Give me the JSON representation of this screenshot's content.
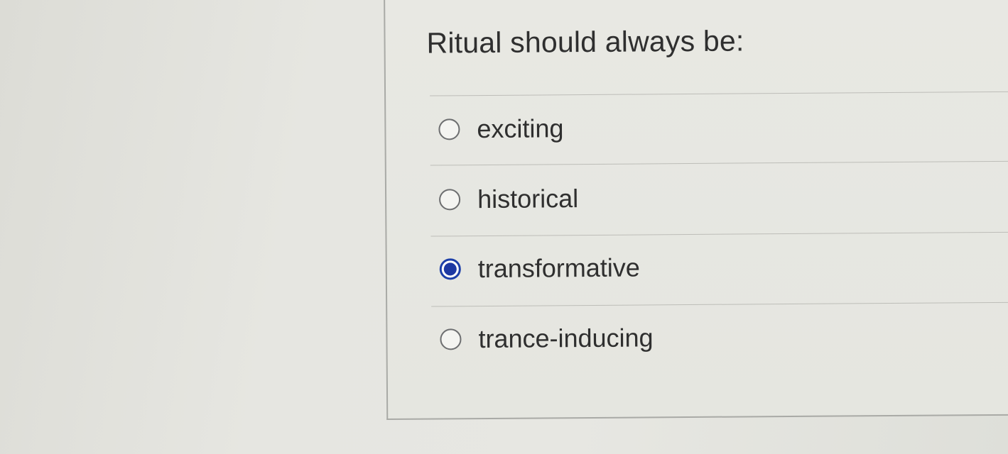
{
  "question": {
    "text": "Ritual should always be:"
  },
  "options": [
    {
      "label": "exciting",
      "selected": false
    },
    {
      "label": "historical",
      "selected": false
    },
    {
      "label": "transformative",
      "selected": true
    },
    {
      "label": "trance-inducing",
      "selected": false
    }
  ],
  "colors": {
    "selected_radio": "#1d39a3",
    "text": "#2f2f2f",
    "background": "#e6e6e1"
  }
}
